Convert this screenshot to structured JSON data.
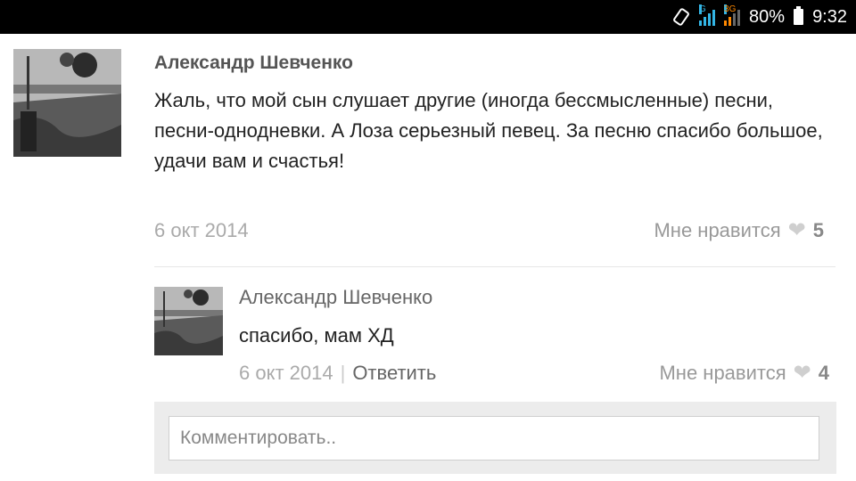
{
  "status_bar": {
    "network_1": "G",
    "network_2": "3G",
    "battery": "80%",
    "time": "9:32",
    "icons": [
      "rotate-icon",
      "signal-icon",
      "signal-icon",
      "battery-icon"
    ]
  },
  "comment": {
    "author": "Александр Шевченко",
    "text": "Жаль, что мой сын слушает другие (иногда бессмысленные) песни, песни-однодневки. А Лоза серьезный певец. За песню спасибо большое, удачи вам и счастья!",
    "date": "6 окт 2014",
    "like_label": "Мне нравится",
    "like_count": "5"
  },
  "reply": {
    "author": "Александр Шевченко",
    "text": "спасибо, мам ХД",
    "date": "6 окт 2014",
    "separator": "|",
    "reply_label": "Ответить",
    "like_label": "Мне нравится",
    "like_count": "4"
  },
  "comment_input": {
    "placeholder": "Комментировать.."
  },
  "colors": {
    "status_bar_bg": "#000000",
    "signal_accent": "#33b5e5",
    "comment_area_bg": "#ececec"
  }
}
